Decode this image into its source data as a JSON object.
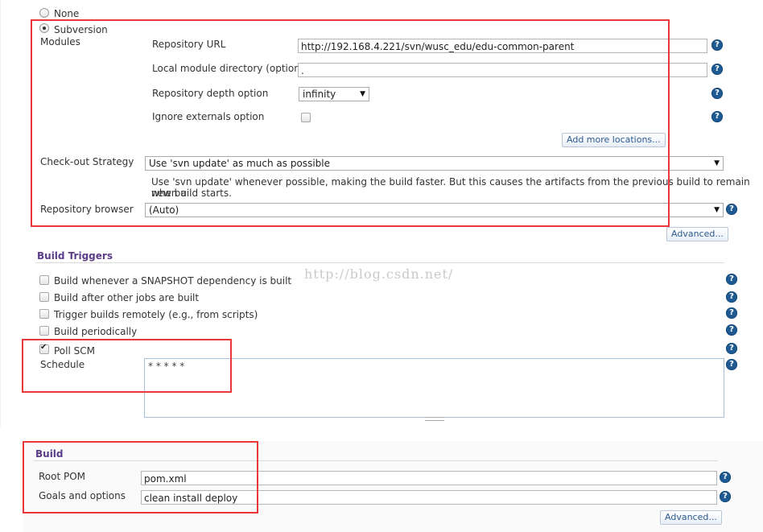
{
  "scm": {
    "none_label": "None",
    "subversion_label": "Subversion",
    "modules_label": "Modules",
    "repo_url_label": "Repository URL",
    "repo_url_value": "http://192.168.4.221/svn/wusc_edu/edu-common-parent",
    "local_dir_label": "Local module directory (optional)",
    "local_dir_value": ".",
    "depth_label": "Repository depth option",
    "depth_value": "infinity",
    "ignore_label": "Ignore externals option",
    "add_more_label": "Add more locations...",
    "checkout_label": "Check-out Strategy",
    "checkout_value": "Use 'svn update' as much as possible",
    "checkout_desc_line1": "Use 'svn update' whenever possible, making the build faster. But this causes the artifacts from the previous build to remain when a",
    "checkout_desc_line2": "new build starts.",
    "browser_label": "Repository browser",
    "browser_value": "(Auto)",
    "advanced_label": "Advanced..."
  },
  "triggers": {
    "title": "Build Triggers",
    "items": [
      {
        "label": "Build whenever a SNAPSHOT dependency is built",
        "checked": false
      },
      {
        "label": "Build after other jobs are built",
        "checked": false
      },
      {
        "label": "Trigger builds remotely (e.g., from scripts)",
        "checked": false
      },
      {
        "label": "Build periodically",
        "checked": false
      },
      {
        "label": "Poll SCM",
        "checked": true
      }
    ],
    "schedule_label": "Schedule",
    "schedule_value": "* * * * *"
  },
  "build": {
    "title": "Build",
    "root_pom_label": "Root POM",
    "root_pom_value": "pom.xml",
    "goals_label": "Goals and options",
    "goals_value": "clean install deploy",
    "advanced_label": "Advanced..."
  },
  "watermark": "http://blog.csdn.net/",
  "icons": {
    "help": "?",
    "dropdown": "▼"
  },
  "colors": {
    "highlight_box": "#e8383a",
    "section_title": "#5b3c87",
    "help_icon": "#1f5a92",
    "link_button_text": "#2b5a92"
  }
}
